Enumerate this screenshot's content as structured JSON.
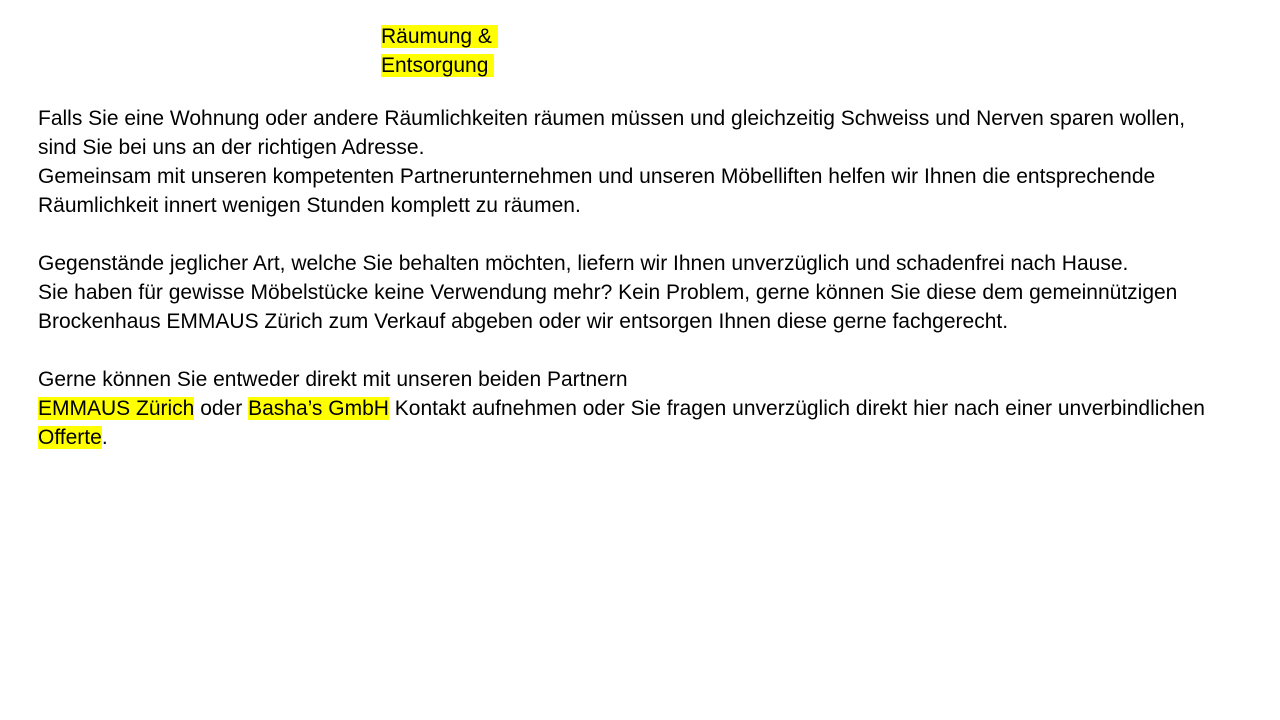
{
  "title": {
    "line1": "Räumung &",
    "line2": "Entsorgung"
  },
  "paragraphs": {
    "p1": "Falls Sie eine Wohnung oder andere Räumlichkeiten räumen müssen und gleichzeitig Schweiss und Nerven sparen wollen, sind Sie bei uns an der richtigen Adresse.",
    "p2": "Gemeinsam mit unseren kompetenten Partnerunternehmen und unseren Möbelliften helfen wir Ihnen die entsprechende Räumlichkeit innert wenigen Stunden komplett zu räumen.",
    "p3": "Gegenstände jeglicher Art, welche Sie behalten möchten, liefern wir Ihnen unverzüglich und schadenfrei nach Hause.",
    "p4": "Sie haben für gewisse Möbelstücke keine Verwendung mehr? Kein Problem, gerne können Sie diese dem gemeinnützigen Brockenhaus EMMAUS Zürich zum Verkauf abgeben oder wir entsorgen Ihnen diese gerne fachgerecht.",
    "p5": "Gerne können Sie entweder direkt mit unseren beiden Partnern"
  },
  "contact_line": {
    "partner1": "EMMAUS Zürich",
    "connector1": "oder",
    "partner2": "Basha’s GmbH",
    "connector2": "Kontakt aufnehmen oder Sie fragen unverzüglich direkt hier nach einer unverbindlichen",
    "offer": "Offerte",
    "end": "."
  },
  "colors": {
    "highlight": "#ffff00",
    "text": "#000000",
    "background": "#ffffff"
  }
}
